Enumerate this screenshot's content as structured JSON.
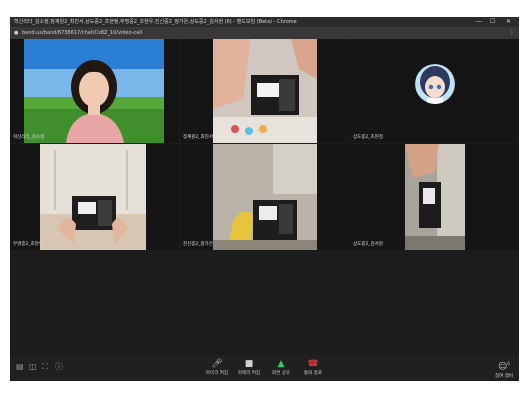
{
  "window": {
    "title": "혁신리더_김소정,정계원2_최진서,상도중2_조현정,무명중2_조현우,진신중2_정가은,상도중2_김서현 (6) - 밴드모임 (Beta) - Chrome",
    "url": "band.us/band/8738617/chat/CsBZ_10/video-call",
    "controls": [
      "—",
      "☐",
      "✕"
    ]
  },
  "participants": [
    {
      "name": "혁신리더_김소정",
      "video": "person"
    },
    {
      "name": "정계원2_최진서",
      "video": "camera-1"
    },
    {
      "name": "상도중2_조현정",
      "video": "avatar"
    },
    {
      "name": "무명중2_조현우",
      "video": "camera-2"
    },
    {
      "name": "진신중2_정가은",
      "video": "camera-3"
    },
    {
      "name": "상도중2_김서현",
      "video": "camera-4"
    }
  ],
  "toolbar": {
    "mic_label": "마이크 켜짐",
    "camera_label": "카메라 켜짐",
    "share_label": "화면 공유",
    "end_label": "통화 종료",
    "participants_label": "참여 멤버",
    "participant_count": "6"
  },
  "colors": {
    "share": "#2ecc71",
    "end": "#e53935"
  }
}
